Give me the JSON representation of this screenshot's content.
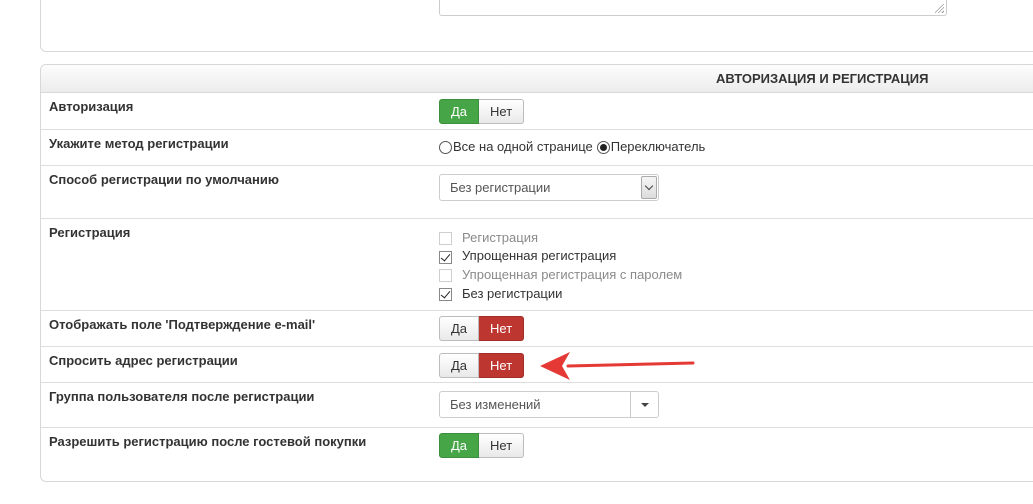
{
  "section": {
    "title": "АВТОРИЗАЦИЯ И РЕГИСТРАЦИЯ"
  },
  "rows": {
    "authorization": {
      "label": "Авторизация",
      "yes": "Да",
      "no": "Нет",
      "selected": "yes"
    },
    "reg_method": {
      "label": "Укажите метод регистрации",
      "option1": "Все на одной странице",
      "option2": "Переключатель",
      "selected": "option2"
    },
    "default_reg": {
      "label": "Способ регистрации по умолчанию",
      "value": "Без регистрации"
    },
    "registration": {
      "label": "Регистрация",
      "items": [
        {
          "label": "Регистрация",
          "checked": false,
          "disabled": true
        },
        {
          "label": "Упрощенная регистрация",
          "checked": true,
          "disabled": false
        },
        {
          "label": "Упрощенная регистрация с паролем",
          "checked": false,
          "disabled": true
        },
        {
          "label": "Без регистрации",
          "checked": true,
          "disabled": false
        }
      ]
    },
    "confirm_email": {
      "label": "Отображать поле 'Подтверждение e-mail'",
      "yes": "Да",
      "no": "Нет",
      "selected": "no"
    },
    "ask_address": {
      "label": "Спросить адрес регистрации",
      "yes": "Да",
      "no": "Нет",
      "selected": "no"
    },
    "user_group": {
      "label": "Группа пользователя после регистрации",
      "value": "Без изменений"
    },
    "guest_reg": {
      "label": "Разрешить регистрацию после гостевой покупки",
      "yes": "Да",
      "no": "Нет",
      "selected": "yes"
    }
  },
  "colors": {
    "green": "#46a546",
    "red": "#bd362f",
    "arrow": "#e53935"
  },
  "icons": {
    "annotation_arrow": "red-arrow-icon",
    "select_arrow": "chevron-down-icon",
    "select_caret": "caret-down-icon",
    "resize": "resize-grip-icon"
  }
}
